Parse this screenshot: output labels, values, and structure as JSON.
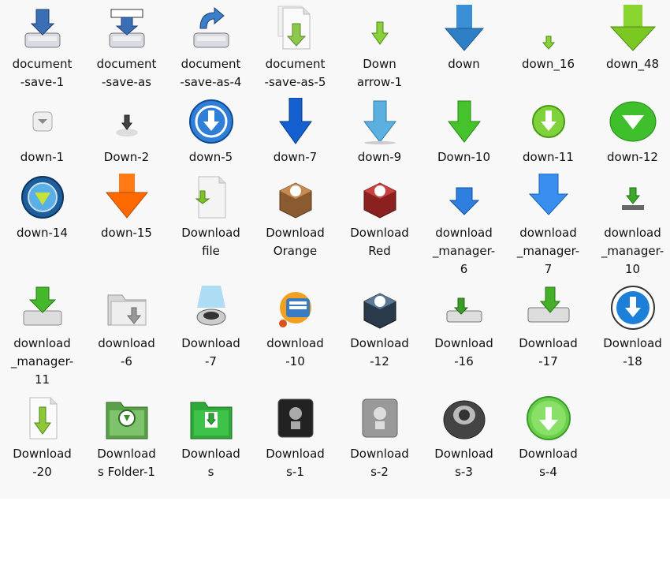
{
  "files": [
    {
      "label": "document\n-save-1",
      "icon": "document-save-icon"
    },
    {
      "label": "document\n-save-as",
      "icon": "document-save-as-icon"
    },
    {
      "label": "document\n-save-as-4",
      "icon": "document-save-as-4-icon"
    },
    {
      "label": "document\n-save-as-5",
      "icon": "document-save-as-5-icon"
    },
    {
      "label": "Down\narrow-1",
      "icon": "down-arrow-1-icon"
    },
    {
      "label": "down",
      "icon": "down-icon"
    },
    {
      "label": "down_16",
      "icon": "down-16-icon"
    },
    {
      "label": "down_48",
      "icon": "down-48-icon"
    },
    {
      "label": "down-1",
      "icon": "down-1-icon"
    },
    {
      "label": "Down-2",
      "icon": "down-2-icon"
    },
    {
      "label": "down-5",
      "icon": "down-5-icon"
    },
    {
      "label": "down-7",
      "icon": "down-7-icon"
    },
    {
      "label": "down-9",
      "icon": "down-9-icon"
    },
    {
      "label": "Down-10",
      "icon": "down-10-icon"
    },
    {
      "label": "down-11",
      "icon": "down-11-icon"
    },
    {
      "label": "down-12",
      "icon": "down-12-icon"
    },
    {
      "label": "down-14",
      "icon": "down-14-icon"
    },
    {
      "label": "down-15",
      "icon": "down-15-icon"
    },
    {
      "label": "Download\nfile",
      "icon": "download-file-icon"
    },
    {
      "label": "Download\nOrange",
      "icon": "download-orange-icon"
    },
    {
      "label": "Download\nRed",
      "icon": "download-red-icon"
    },
    {
      "label": "download\n_manager-\n6",
      "icon": "download-manager-6-icon"
    },
    {
      "label": "download\n_manager-\n7",
      "icon": "download-manager-7-icon"
    },
    {
      "label": "download\n_manager-\n10",
      "icon": "download-manager-10-icon"
    },
    {
      "label": "download\n_manager-\n11",
      "icon": "download-manager-11-icon"
    },
    {
      "label": "download\n-6",
      "icon": "download-6-icon"
    },
    {
      "label": "Download\n-7",
      "icon": "download-7-icon"
    },
    {
      "label": "download\n-10",
      "icon": "download-10-icon"
    },
    {
      "label": "Download\n-12",
      "icon": "download-12-icon"
    },
    {
      "label": "Download\n-16",
      "icon": "download-16-icon"
    },
    {
      "label": "Download\n-17",
      "icon": "download-17-icon"
    },
    {
      "label": "Download\n-18",
      "icon": "download-18-icon"
    },
    {
      "label": "Download\n-20",
      "icon": "download-20-icon"
    },
    {
      "label": "Download\ns Folder-1",
      "icon": "downloads-folder-1-icon"
    },
    {
      "label": "Download\ns",
      "icon": "downloads-icon"
    },
    {
      "label": "Download\ns-1",
      "icon": "downloads-1-icon"
    },
    {
      "label": "Download\ns-2",
      "icon": "downloads-2-icon"
    },
    {
      "label": "Download\ns-3",
      "icon": "downloads-3-icon"
    },
    {
      "label": "Download\ns-4",
      "icon": "downloads-4-icon"
    }
  ]
}
